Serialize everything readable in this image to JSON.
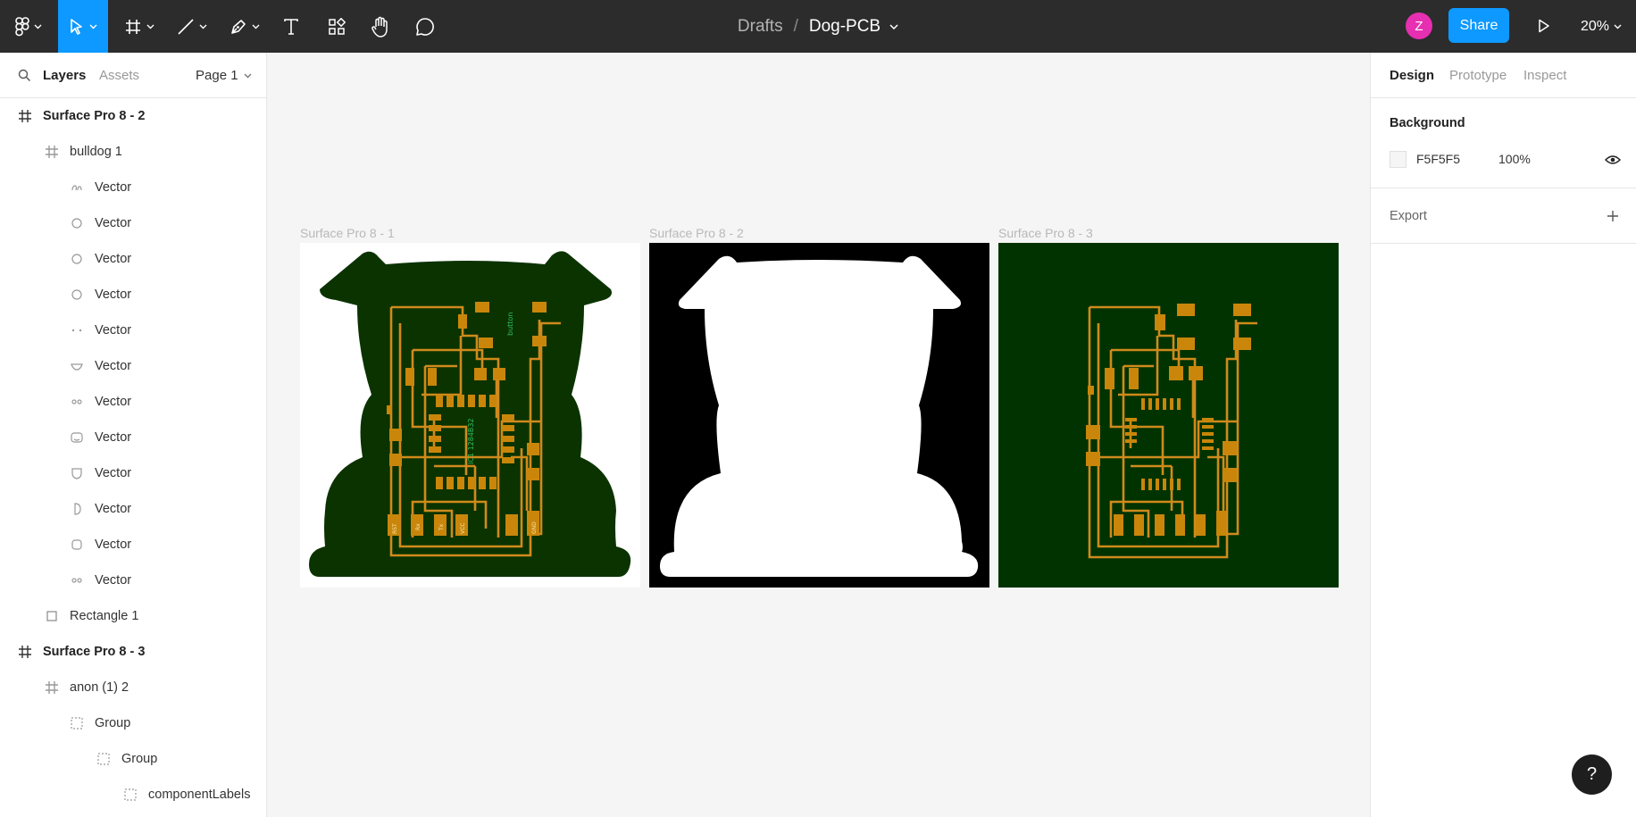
{
  "toolbar": {
    "breadcrumb_drafts": "Drafts",
    "breadcrumb_sep": "/",
    "file_name": "Dog-PCB",
    "avatar_initial": "Z",
    "share_label": "Share",
    "zoom": "20%"
  },
  "left_panel": {
    "tab_layers": "Layers",
    "tab_assets": "Assets",
    "page": "Page 1",
    "layers": [
      {
        "name": "Surface Pro 8 - 2",
        "icon": "frame-icon",
        "bold": true
      },
      {
        "name": "bulldog 1",
        "icon": "frame-icon"
      },
      {
        "name": "Vector",
        "icon": "vector-icon"
      },
      {
        "name": "Vector",
        "icon": "circle-icon"
      },
      {
        "name": "Vector",
        "icon": "circle-icon"
      },
      {
        "name": "Vector",
        "icon": "circle-icon"
      },
      {
        "name": "Vector",
        "icon": "dots-icon"
      },
      {
        "name": "Vector",
        "icon": "shape-icon"
      },
      {
        "name": "Vector",
        "icon": "eyes-icon"
      },
      {
        "name": "Vector",
        "icon": "face-icon"
      },
      {
        "name": "Vector",
        "icon": "shield-icon"
      },
      {
        "name": "Vector",
        "icon": "half-circle-icon"
      },
      {
        "name": "Vector",
        "icon": "rounded-square-icon"
      },
      {
        "name": "Vector",
        "icon": "eyes-icon"
      },
      {
        "name": "Rectangle 1",
        "icon": "rectangle-icon"
      },
      {
        "name": "Surface Pro 8 - 3",
        "icon": "frame-icon",
        "bold": true
      },
      {
        "name": "anon (1) 2",
        "icon": "frame-icon"
      },
      {
        "name": "Group",
        "icon": "group-icon"
      },
      {
        "name": "Group",
        "icon": "group-icon"
      },
      {
        "name": "componentLabels",
        "icon": "group-icon"
      }
    ]
  },
  "canvas": {
    "frames": [
      {
        "label": "Surface Pro 8 - 1"
      },
      {
        "label": "Surface Pro 8 - 2"
      },
      {
        "label": "Surface Pro 8 - 3"
      }
    ],
    "pcb_labels": {
      "ic": "IC1 1284B32",
      "vcc": "VCC",
      "gnd": "GND",
      "rx": "Rx",
      "tx": "Tx",
      "rst": "RST",
      "button": "button"
    }
  },
  "right_panel": {
    "tab_design": "Design",
    "tab_prototype": "Prototype",
    "tab_inspect": "Inspect",
    "background_title": "Background",
    "background_hex": "F5F5F5",
    "background_opacity": "100%",
    "export_title": "Export"
  },
  "help": "?",
  "colors": {
    "toolbar": "#2c2c2c",
    "accent": "#0d99ff",
    "avatar": "#e62fb1",
    "board_green": "#0b3300",
    "copper": "#c9860a",
    "trace": "#d08a1c"
  }
}
